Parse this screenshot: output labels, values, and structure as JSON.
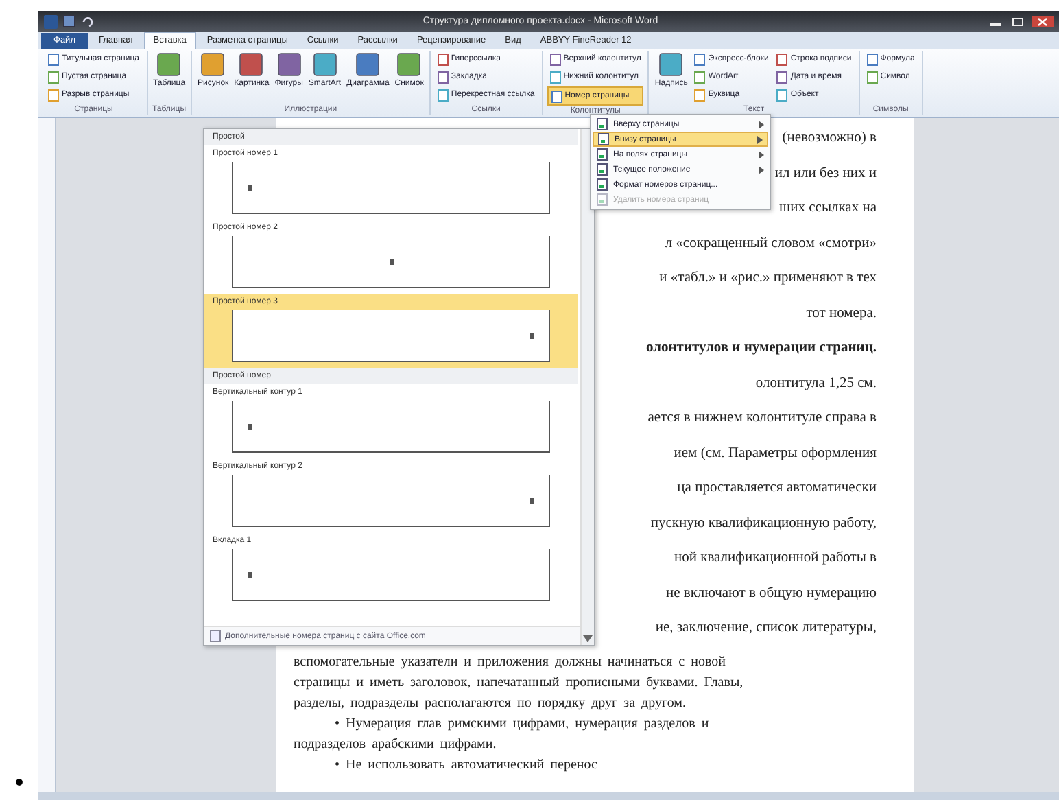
{
  "window": {
    "title": "Структура дипломного проекта.docx - Microsoft Word"
  },
  "tabs": [
    {
      "label": "Файл",
      "kind": "file",
      "selected": false
    },
    {
      "label": "Главная",
      "kind": "tab",
      "selected": false
    },
    {
      "label": "Вставка",
      "kind": "tab",
      "selected": true
    },
    {
      "label": "Разметка страницы",
      "kind": "tab",
      "selected": false
    },
    {
      "label": "Ссылки",
      "kind": "tab",
      "selected": false
    },
    {
      "label": "Рассылки",
      "kind": "tab",
      "selected": false
    },
    {
      "label": "Рецензирование",
      "kind": "tab",
      "selected": false
    },
    {
      "label": "Вид",
      "kind": "tab",
      "selected": false
    },
    {
      "label": "ABBYY FineReader 12",
      "kind": "tab",
      "selected": false
    }
  ],
  "ribbon_groups": [
    {
      "label": "Страницы",
      "controls": [
        {
          "label": "Титульная страница",
          "kind": "small",
          "selected": false
        },
        {
          "label": "Пустая страница",
          "kind": "small",
          "selected": false
        },
        {
          "label": "Разрыв страницы",
          "kind": "small",
          "selected": false
        }
      ]
    },
    {
      "label": "Таблицы",
      "controls": [
        {
          "label": "Таблица",
          "kind": "large",
          "selected": false
        }
      ]
    },
    {
      "label": "Иллюстрации",
      "controls": [
        {
          "label": "Рисунок",
          "kind": "large",
          "selected": false
        },
        {
          "label": "Картинка",
          "kind": "large",
          "selected": false
        },
        {
          "label": "Фигуры",
          "kind": "large",
          "selected": false
        },
        {
          "label": "SmartArt",
          "kind": "large",
          "selected": false
        },
        {
          "label": "Диаграмма",
          "kind": "large",
          "selected": false
        },
        {
          "label": "Снимок",
          "kind": "large",
          "selected": false
        }
      ]
    },
    {
      "label": "Ссылки",
      "controls": [
        {
          "label": "Гиперссылка",
          "kind": "small",
          "selected": false
        },
        {
          "label": "Закладка",
          "kind": "small",
          "selected": false
        },
        {
          "label": "Перекрестная ссылка",
          "kind": "small",
          "selected": false
        }
      ]
    },
    {
      "label": "Колонтитулы",
      "controls": [
        {
          "label": "Верхний колонтитул",
          "kind": "small",
          "selected": false
        },
        {
          "label": "Нижний колонтитул",
          "kind": "small",
          "selected": false
        },
        {
          "label": "Номер страницы",
          "kind": "small",
          "selected": true
        }
      ]
    },
    {
      "label": "Текст",
      "controls": [
        {
          "label": "Надпись",
          "kind": "large",
          "selected": false
        },
        {
          "label": "Экспресс-блоки",
          "kind": "small",
          "selected": false
        },
        {
          "label": "WordArt",
          "kind": "small",
          "selected": false
        },
        {
          "label": "Буквица",
          "kind": "small",
          "selected": false
        },
        {
          "label": "Строка подписи",
          "kind": "small",
          "selected": false
        },
        {
          "label": "Дата и время",
          "kind": "small",
          "selected": false
        },
        {
          "label": "Объект",
          "kind": "small",
          "selected": false
        }
      ]
    },
    {
      "label": "Символы",
      "controls": [
        {
          "label": "Формула",
          "kind": "small",
          "selected": false
        },
        {
          "label": "Символ",
          "kind": "small",
          "selected": false
        }
      ]
    }
  ],
  "page_number_menu": [
    {
      "label": "Вверху страницы",
      "selected": false,
      "disabled": false,
      "submenu": true
    },
    {
      "label": "Внизу страницы",
      "selected": true,
      "disabled": false,
      "submenu": true
    },
    {
      "label": "На полях страницы",
      "selected": false,
      "disabled": false,
      "submenu": true
    },
    {
      "label": "Текущее положение",
      "selected": false,
      "disabled": false,
      "submenu": true
    },
    {
      "label": "Формат номеров страниц...",
      "selected": false,
      "disabled": false,
      "submenu": false
    },
    {
      "label": "Удалить номера страниц",
      "selected": false,
      "disabled": true,
      "submenu": false
    }
  ],
  "gallery": {
    "items": [
      {
        "kind": "category",
        "label": "Простой"
      },
      {
        "kind": "left",
        "label": "Простой номер 1",
        "selected": false
      },
      {
        "kind": "center",
        "label": "Простой номер 2",
        "selected": false
      },
      {
        "kind": "right",
        "label": "Простой номер 3",
        "selected": true
      },
      {
        "kind": "category",
        "label": "Простой номер"
      },
      {
        "kind": "left",
        "label": "Вертикальный контур 1",
        "selected": false
      },
      {
        "kind": "right",
        "label": "Вертикальный контур 2",
        "selected": false
      },
      {
        "kind": "left",
        "label": "Вкладка 1",
        "selected": false
      }
    ],
    "footer": "Дополнительные номера страниц с сайта Office.com"
  },
  "document": {
    "lines": [
      {
        "kind": "fragment",
        "text": "(невозможно) в"
      },
      {
        "kind": "fragment",
        "text": "ил или без них и"
      },
      {
        "kind": "fragment",
        "text": "ших ссылках на"
      },
      {
        "kind": "fragment",
        "text": "л «сокращенный словом «смотри»"
      },
      {
        "kind": "fragment",
        "text": "и «табл.» и «рис.» применяют в тех"
      },
      {
        "kind": "fragment",
        "text": "тот номера."
      },
      {
        "kind": "heading",
        "text": "олонтитулов и нумерации страниц."
      },
      {
        "kind": "fragment",
        "text": "олонтитула 1,25 см."
      },
      {
        "kind": "fragment",
        "text": "ается в нижнем колонтитуле справа в"
      },
      {
        "kind": "fragment",
        "text": "ием (см. Параметры оформления"
      },
      {
        "kind": "fragment",
        "text": "ца проставляется автоматически"
      },
      {
        "kind": "fragment",
        "text": "пускную квалификационную работу,"
      },
      {
        "kind": "fragment",
        "text": "ной квалификационной работы в"
      },
      {
        "kind": "fragment",
        "text": "не включают в общую нумерацию"
      },
      {
        "kind": "fragment",
        "text": "ие, заключение, список литературы,"
      },
      {
        "kind": "full",
        "text": "вспомогательные указатели и приложения должны начинаться с новой"
      },
      {
        "kind": "full",
        "text": "страницы и иметь заголовок, напечатанный прописными буквами. Главы,"
      },
      {
        "kind": "full",
        "text": "разделы, подразделы располагаются по порядку друг за другом."
      },
      {
        "kind": "bullet",
        "text": "• Нумерация глав римскими цифрами, нумерация разделов и"
      },
      {
        "kind": "full",
        "text": "подразделов арабскими цифрами."
      },
      {
        "kind": "bullet",
        "text": "• Не использовать автоматический перенос"
      }
    ]
  },
  "outside_mark": "•"
}
